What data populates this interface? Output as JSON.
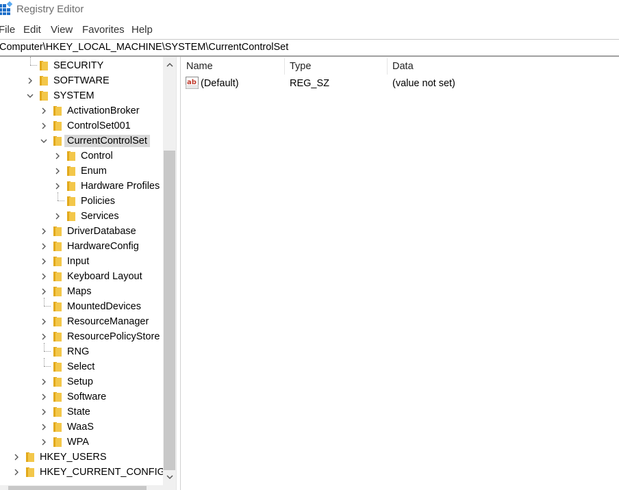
{
  "window": {
    "title": "Registry Editor"
  },
  "menu": [
    "File",
    "Edit",
    "View",
    "Favorites",
    "Help"
  ],
  "address": "Computer\\HKEY_LOCAL_MACHINE\\SYSTEM\\CurrentControlSet",
  "tree": [
    {
      "label": "SECURITY",
      "chevron": "none",
      "level": 0,
      "dotted": true
    },
    {
      "label": "SOFTWARE",
      "chevron": "right",
      "level": 0
    },
    {
      "label": "SYSTEM",
      "chevron": "down",
      "level": 0
    },
    {
      "label": "ActivationBroker",
      "chevron": "right",
      "level": 1
    },
    {
      "label": "ControlSet001",
      "chevron": "right",
      "level": 1
    },
    {
      "label": "CurrentControlSet",
      "chevron": "down",
      "level": 1,
      "selected": true
    },
    {
      "label": "Control",
      "chevron": "right",
      "level": 2
    },
    {
      "label": "Enum",
      "chevron": "right",
      "level": 2
    },
    {
      "label": "Hardware Profiles",
      "chevron": "right",
      "level": 2
    },
    {
      "label": "Policies",
      "chevron": "none",
      "level": 2,
      "dotted": true
    },
    {
      "label": "Services",
      "chevron": "right",
      "level": 2
    },
    {
      "label": "DriverDatabase",
      "chevron": "right",
      "level": 1
    },
    {
      "label": "HardwareConfig",
      "chevron": "right",
      "level": 1
    },
    {
      "label": "Input",
      "chevron": "right",
      "level": 1
    },
    {
      "label": "Keyboard Layout",
      "chevron": "right",
      "level": 1
    },
    {
      "label": "Maps",
      "chevron": "right",
      "level": 1
    },
    {
      "label": "MountedDevices",
      "chevron": "none",
      "level": 1,
      "dotted": true
    },
    {
      "label": "ResourceManager",
      "chevron": "right",
      "level": 1
    },
    {
      "label": "ResourcePolicyStore",
      "chevron": "right",
      "level": 1
    },
    {
      "label": "RNG",
      "chevron": "none",
      "level": 1,
      "dotted": true
    },
    {
      "label": "Select",
      "chevron": "none",
      "level": 1,
      "dotted": true
    },
    {
      "label": "Setup",
      "chevron": "right",
      "level": 1
    },
    {
      "label": "Software",
      "chevron": "right",
      "level": 1
    },
    {
      "label": "State",
      "chevron": "right",
      "level": 1
    },
    {
      "label": "WaaS",
      "chevron": "right",
      "level": 1
    },
    {
      "label": "WPA",
      "chevron": "right",
      "level": 1
    },
    {
      "label": "HKEY_USERS",
      "chevron": "right",
      "level": -1
    },
    {
      "label": "HKEY_CURRENT_CONFIG",
      "chevron": "right",
      "level": -1
    }
  ],
  "columns": [
    "Name",
    "Type",
    "Data"
  ],
  "values": [
    {
      "name": "(Default)",
      "type": "REG_SZ",
      "data": "(value not set)",
      "icon": "string-value-icon"
    }
  ],
  "colors": {
    "folder": "#f3c74a",
    "folder_dark": "#e2a91c",
    "selection": "#d9d9d9",
    "ab_red": "#c0392b"
  }
}
